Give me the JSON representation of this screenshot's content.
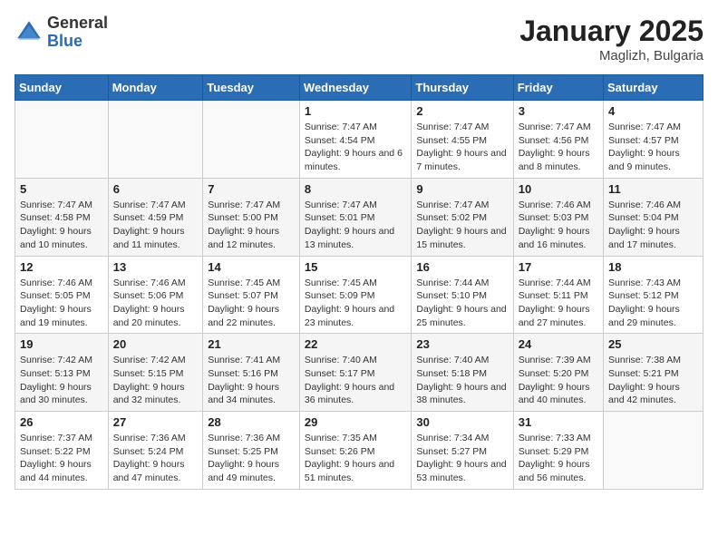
{
  "header": {
    "logo_general": "General",
    "logo_blue": "Blue",
    "title": "January 2025",
    "subtitle": "Maglizh, Bulgaria"
  },
  "weekdays": [
    "Sunday",
    "Monday",
    "Tuesday",
    "Wednesday",
    "Thursday",
    "Friday",
    "Saturday"
  ],
  "weeks": [
    [
      {
        "day": "",
        "info": ""
      },
      {
        "day": "",
        "info": ""
      },
      {
        "day": "",
        "info": ""
      },
      {
        "day": "1",
        "info": "Sunrise: 7:47 AM\nSunset: 4:54 PM\nDaylight: 9 hours and 6 minutes."
      },
      {
        "day": "2",
        "info": "Sunrise: 7:47 AM\nSunset: 4:55 PM\nDaylight: 9 hours and 7 minutes."
      },
      {
        "day": "3",
        "info": "Sunrise: 7:47 AM\nSunset: 4:56 PM\nDaylight: 9 hours and 8 minutes."
      },
      {
        "day": "4",
        "info": "Sunrise: 7:47 AM\nSunset: 4:57 PM\nDaylight: 9 hours and 9 minutes."
      }
    ],
    [
      {
        "day": "5",
        "info": "Sunrise: 7:47 AM\nSunset: 4:58 PM\nDaylight: 9 hours and 10 minutes."
      },
      {
        "day": "6",
        "info": "Sunrise: 7:47 AM\nSunset: 4:59 PM\nDaylight: 9 hours and 11 minutes."
      },
      {
        "day": "7",
        "info": "Sunrise: 7:47 AM\nSunset: 5:00 PM\nDaylight: 9 hours and 12 minutes."
      },
      {
        "day": "8",
        "info": "Sunrise: 7:47 AM\nSunset: 5:01 PM\nDaylight: 9 hours and 13 minutes."
      },
      {
        "day": "9",
        "info": "Sunrise: 7:47 AM\nSunset: 5:02 PM\nDaylight: 9 hours and 15 minutes."
      },
      {
        "day": "10",
        "info": "Sunrise: 7:46 AM\nSunset: 5:03 PM\nDaylight: 9 hours and 16 minutes."
      },
      {
        "day": "11",
        "info": "Sunrise: 7:46 AM\nSunset: 5:04 PM\nDaylight: 9 hours and 17 minutes."
      }
    ],
    [
      {
        "day": "12",
        "info": "Sunrise: 7:46 AM\nSunset: 5:05 PM\nDaylight: 9 hours and 19 minutes."
      },
      {
        "day": "13",
        "info": "Sunrise: 7:46 AM\nSunset: 5:06 PM\nDaylight: 9 hours and 20 minutes."
      },
      {
        "day": "14",
        "info": "Sunrise: 7:45 AM\nSunset: 5:07 PM\nDaylight: 9 hours and 22 minutes."
      },
      {
        "day": "15",
        "info": "Sunrise: 7:45 AM\nSunset: 5:09 PM\nDaylight: 9 hours and 23 minutes."
      },
      {
        "day": "16",
        "info": "Sunrise: 7:44 AM\nSunset: 5:10 PM\nDaylight: 9 hours and 25 minutes."
      },
      {
        "day": "17",
        "info": "Sunrise: 7:44 AM\nSunset: 5:11 PM\nDaylight: 9 hours and 27 minutes."
      },
      {
        "day": "18",
        "info": "Sunrise: 7:43 AM\nSunset: 5:12 PM\nDaylight: 9 hours and 29 minutes."
      }
    ],
    [
      {
        "day": "19",
        "info": "Sunrise: 7:42 AM\nSunset: 5:13 PM\nDaylight: 9 hours and 30 minutes."
      },
      {
        "day": "20",
        "info": "Sunrise: 7:42 AM\nSunset: 5:15 PM\nDaylight: 9 hours and 32 minutes."
      },
      {
        "day": "21",
        "info": "Sunrise: 7:41 AM\nSunset: 5:16 PM\nDaylight: 9 hours and 34 minutes."
      },
      {
        "day": "22",
        "info": "Sunrise: 7:40 AM\nSunset: 5:17 PM\nDaylight: 9 hours and 36 minutes."
      },
      {
        "day": "23",
        "info": "Sunrise: 7:40 AM\nSunset: 5:18 PM\nDaylight: 9 hours and 38 minutes."
      },
      {
        "day": "24",
        "info": "Sunrise: 7:39 AM\nSunset: 5:20 PM\nDaylight: 9 hours and 40 minutes."
      },
      {
        "day": "25",
        "info": "Sunrise: 7:38 AM\nSunset: 5:21 PM\nDaylight: 9 hours and 42 minutes."
      }
    ],
    [
      {
        "day": "26",
        "info": "Sunrise: 7:37 AM\nSunset: 5:22 PM\nDaylight: 9 hours and 44 minutes."
      },
      {
        "day": "27",
        "info": "Sunrise: 7:36 AM\nSunset: 5:24 PM\nDaylight: 9 hours and 47 minutes."
      },
      {
        "day": "28",
        "info": "Sunrise: 7:36 AM\nSunset: 5:25 PM\nDaylight: 9 hours and 49 minutes."
      },
      {
        "day": "29",
        "info": "Sunrise: 7:35 AM\nSunset: 5:26 PM\nDaylight: 9 hours and 51 minutes."
      },
      {
        "day": "30",
        "info": "Sunrise: 7:34 AM\nSunset: 5:27 PM\nDaylight: 9 hours and 53 minutes."
      },
      {
        "day": "31",
        "info": "Sunrise: 7:33 AM\nSunset: 5:29 PM\nDaylight: 9 hours and 56 minutes."
      },
      {
        "day": "",
        "info": ""
      }
    ]
  ]
}
